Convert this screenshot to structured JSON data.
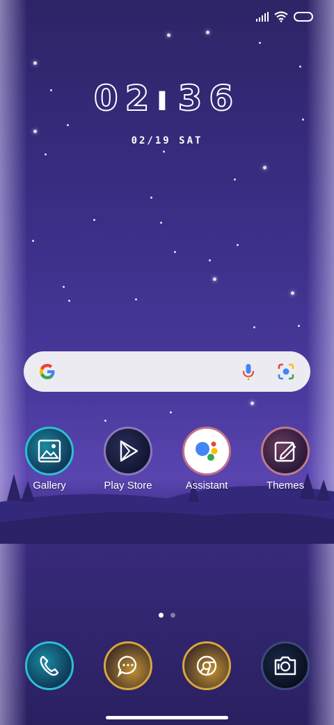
{
  "status_bar": {
    "signal_icon": "signal-icon",
    "wifi_icon": "wifi-icon",
    "battery_icon": "battery-icon"
  },
  "clock": {
    "hours": "02",
    "minutes": "36"
  },
  "date": "02/19 SAT",
  "search": {
    "logo": "google-g-icon",
    "mic": "mic-icon",
    "lens": "lens-icon"
  },
  "apps": [
    {
      "label": "Gallery",
      "icon": "gallery-icon"
    },
    {
      "label": "Play Store",
      "icon": "play-store-icon"
    },
    {
      "label": "Assistant",
      "icon": "assistant-icon"
    },
    {
      "label": "Themes",
      "icon": "themes-icon"
    }
  ],
  "page_indicator": {
    "pages": 2,
    "current": 1
  },
  "dock": [
    {
      "icon": "phone-icon"
    },
    {
      "icon": "messages-icon"
    },
    {
      "icon": "browser-icon"
    },
    {
      "icon": "camera-icon"
    }
  ],
  "colors": {
    "accent_teal": "#1fb5c9",
    "accent_gold": "#d9a73a",
    "accent_pink": "#c2708a"
  }
}
